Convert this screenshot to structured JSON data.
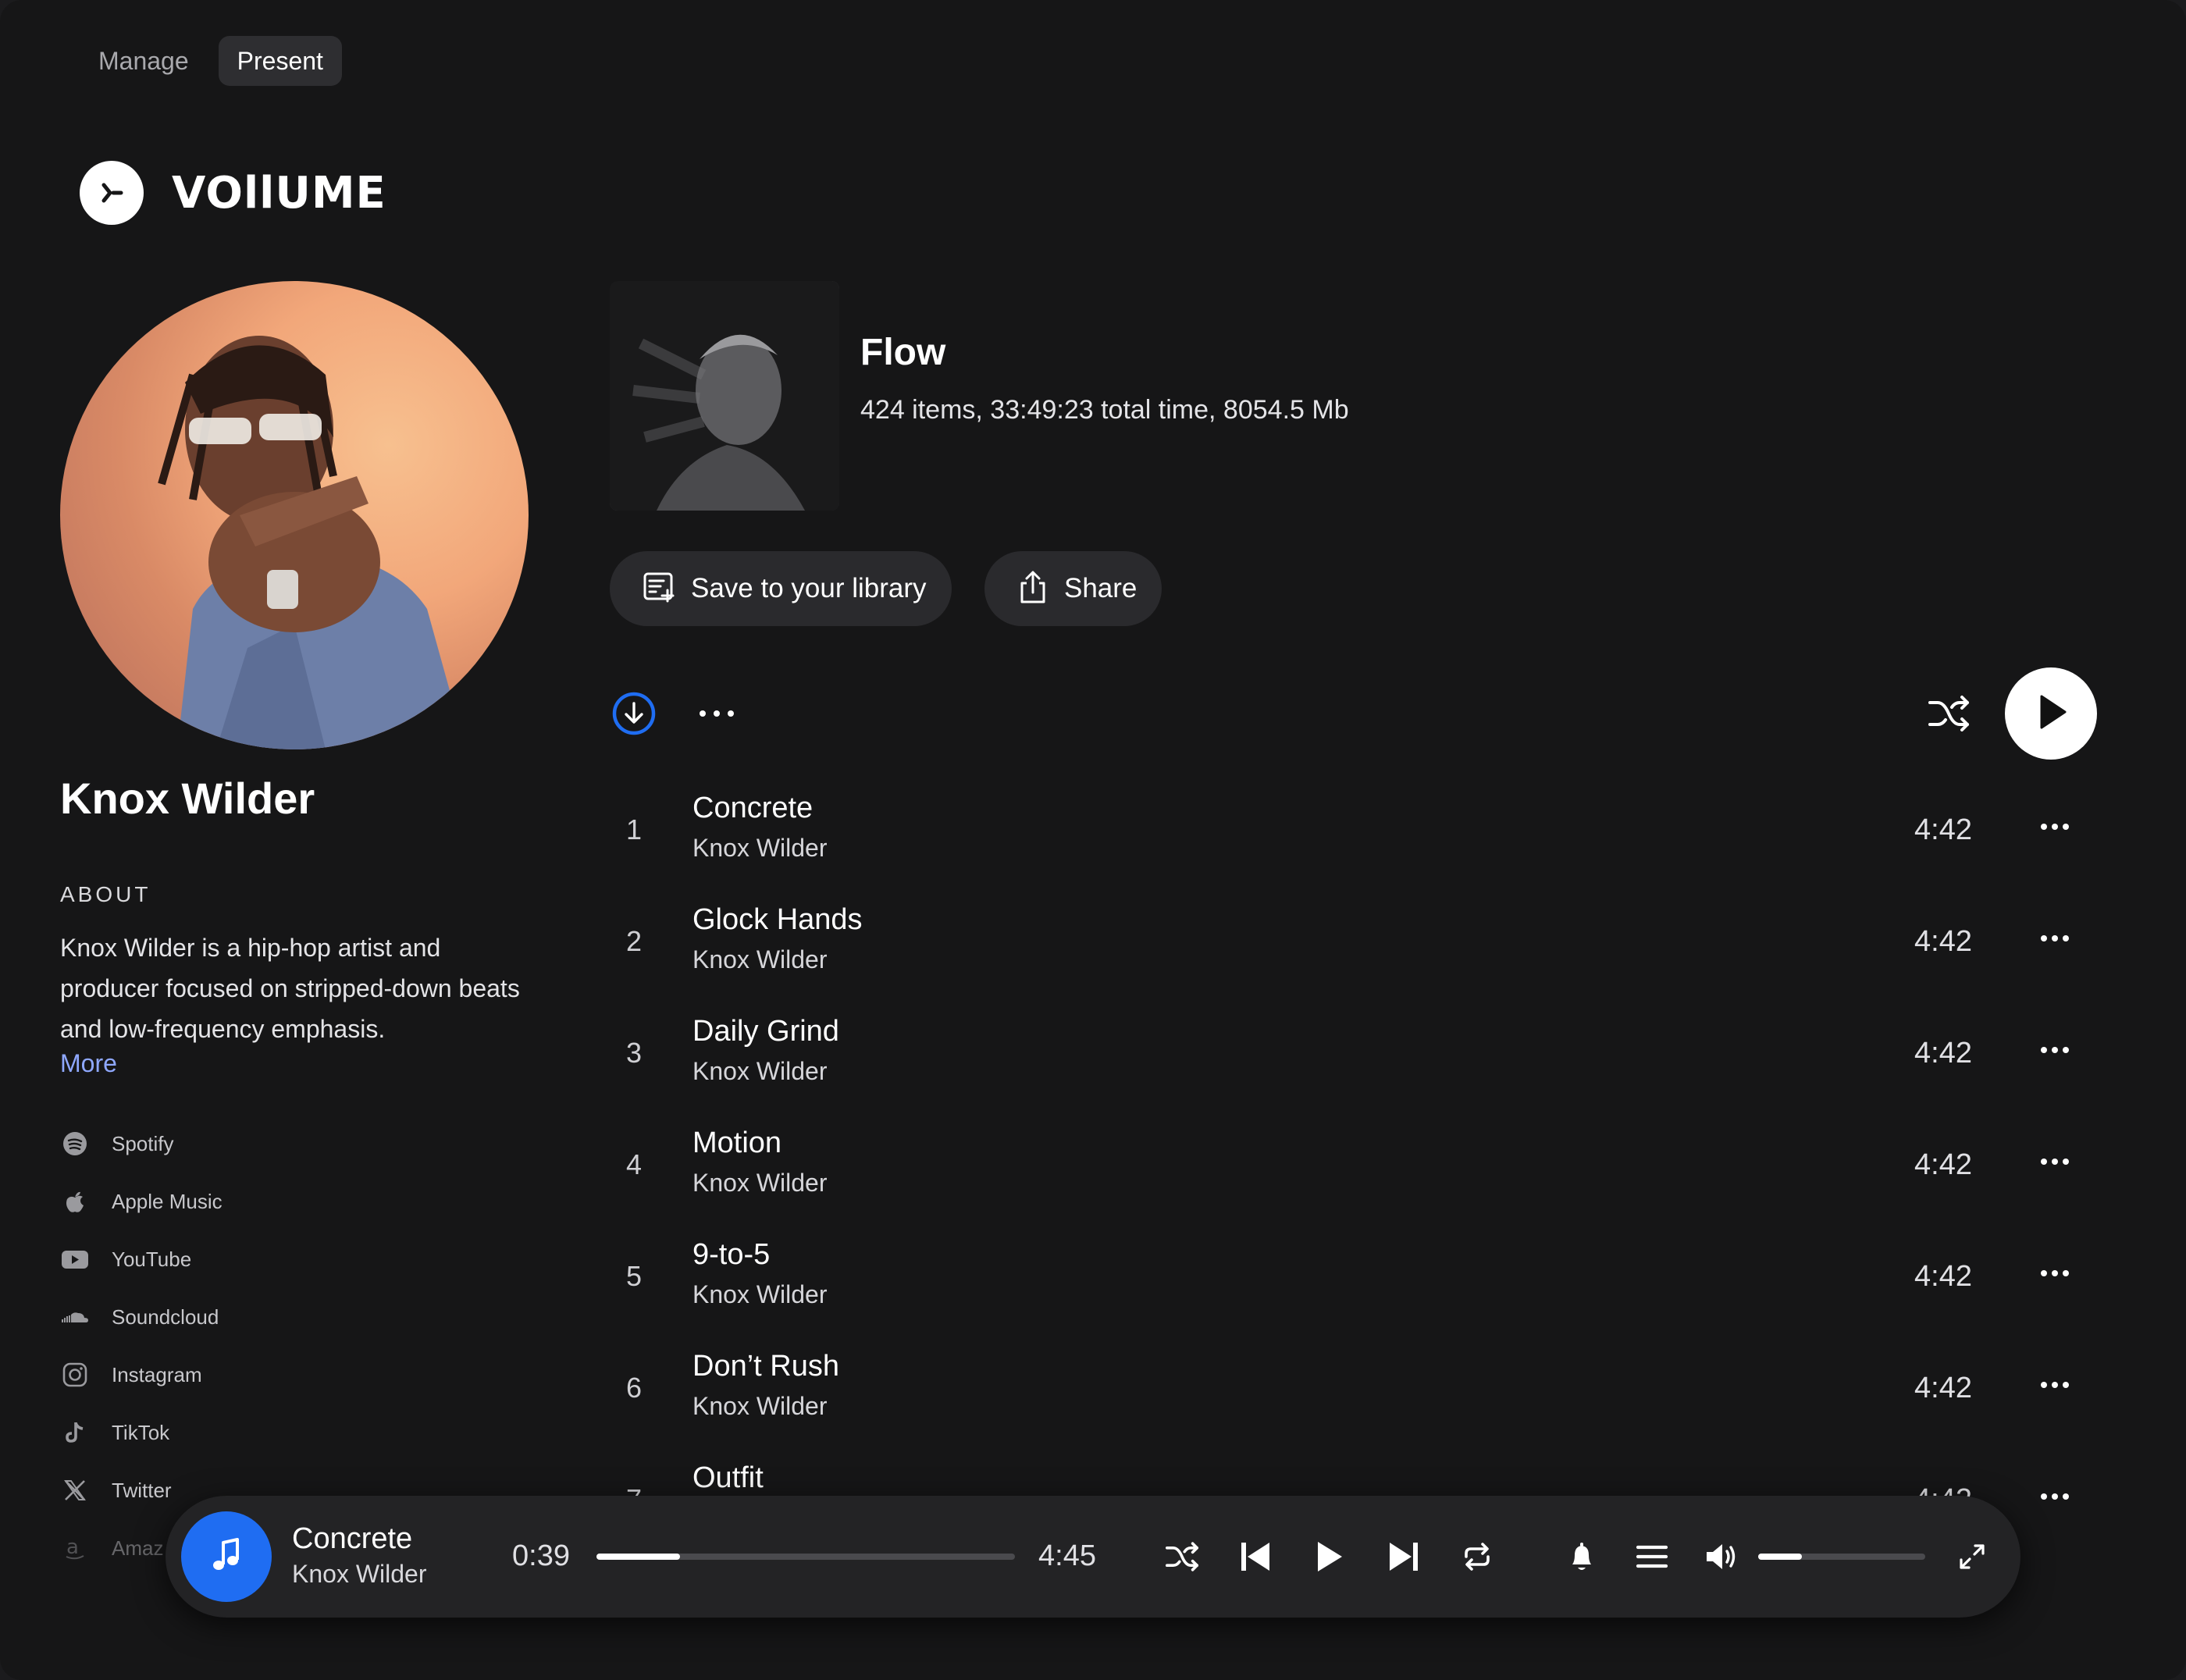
{
  "tabs": [
    {
      "label": "Manage",
      "active": false
    },
    {
      "label": "Present",
      "active": true
    }
  ],
  "brand": {
    "name": "VOllUME"
  },
  "artist": {
    "name": "Knox Wilder",
    "about_heading": "ABOUT",
    "about_text": "Knox Wilder is a hip-hop artist and producer focused on stripped-down beats and low-frequency emphasis.",
    "more_label": "More"
  },
  "socials": [
    {
      "label": "Spotify",
      "icon": "spotify-icon"
    },
    {
      "label": "Apple Music",
      "icon": "apple-icon"
    },
    {
      "label": "YouTube",
      "icon": "youtube-icon"
    },
    {
      "label": "Soundcloud",
      "icon": "soundcloud-icon"
    },
    {
      "label": "Instagram",
      "icon": "instagram-icon"
    },
    {
      "label": "TikTok",
      "icon": "tiktok-icon"
    },
    {
      "label": "Twitter",
      "icon": "x-twitter-icon"
    },
    {
      "label": "Amaz",
      "icon": "amazon-icon"
    }
  ],
  "playlist": {
    "title": "Flow",
    "meta": "424 items, 33:49:23 total time, 8054.5 Mb",
    "save_label": "Save to your library",
    "share_label": "Share"
  },
  "tracks": [
    {
      "num": "1",
      "title": "Concrete",
      "artist": "Knox Wilder",
      "duration": "4:42"
    },
    {
      "num": "2",
      "title": "Glock Hands",
      "artist": "Knox Wilder",
      "duration": "4:42"
    },
    {
      "num": "3",
      "title": "Daily Grind",
      "artist": "Knox Wilder",
      "duration": "4:42"
    },
    {
      "num": "4",
      "title": "Motion",
      "artist": "Knox Wilder",
      "duration": "4:42"
    },
    {
      "num": "5",
      "title": "9-to-5",
      "artist": "Knox Wilder",
      "duration": "4:42"
    },
    {
      "num": "6",
      "title": "Don’t Rush",
      "artist": "Knox Wilder",
      "duration": "4:42"
    },
    {
      "num": "7",
      "title": "Outfit",
      "artist": "",
      "duration": "4:42"
    }
  ],
  "player": {
    "title": "Concrete",
    "artist": "Knox Wilder",
    "current_time": "0:39",
    "total_time": "4:45",
    "progress": 0.2,
    "volume": 0.26
  },
  "colors": {
    "accent": "#1f6df2",
    "link": "#8fa8ff",
    "background": "#161617"
  }
}
